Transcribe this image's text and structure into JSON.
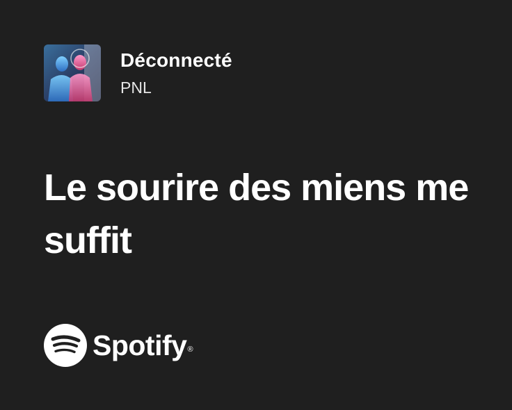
{
  "track": {
    "title": "Déconnecté",
    "artist": "PNL",
    "album_art_icon": "album-cover-image"
  },
  "lyric": {
    "text": "Le sourire des miens me suffit"
  },
  "brand": {
    "icon": "spotify-logo-icon",
    "name": "Spotify",
    "registered_mark": "®",
    "color": "#ffffff"
  },
  "colors": {
    "background": "#1f1f1f",
    "text": "#ffffff"
  }
}
